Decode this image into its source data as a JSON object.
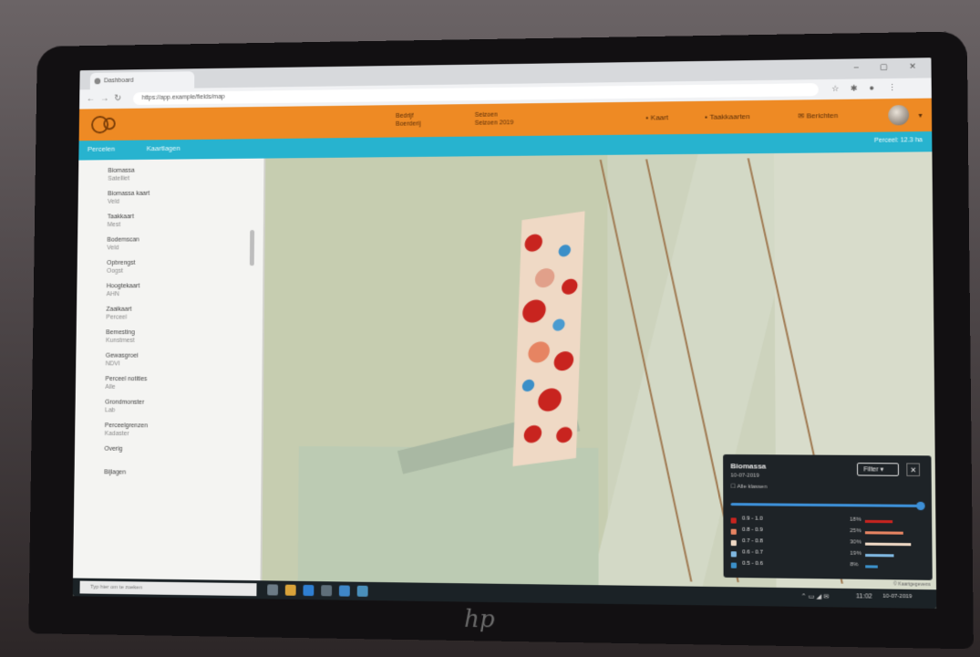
{
  "browser": {
    "tab_title": "Dashboard",
    "address": "https://app.example/fields/map",
    "window_controls": "– ▢ ✕"
  },
  "header": {
    "farm_selector_label": "Bedrijf",
    "farm_selector_value": "Boerderij",
    "period_label": "Seizoen",
    "period_value": "Seizoen 2019",
    "kaart_label": "Kaart",
    "taskmaps_label": "Taakkaarten",
    "berichten_label": "Berichten",
    "colors": {
      "accent": "#ee8a24",
      "sub_bar": "#27b3cf"
    }
  },
  "subbar": {
    "tab_fields": "Percelen",
    "tab_layers": "Kaartlagen",
    "right_text": "Perceel: 12.3 ha"
  },
  "sidebar": {
    "items": [
      {
        "label": "Biomassa",
        "sub": "Satelliet"
      },
      {
        "label": "Biomassa kaart",
        "sub": "Veld"
      },
      {
        "label": "Taakkaart",
        "sub": "Mest"
      },
      {
        "label": "Bodemscan",
        "sub": "Veld"
      },
      {
        "label": "Opbrengst",
        "sub": "Oogst"
      },
      {
        "label": "Hoogtekaart",
        "sub": "AHN"
      },
      {
        "label": "Zaaikaart",
        "sub": "Perceel"
      },
      {
        "label": "Bemesting",
        "sub": "Kunstmest"
      },
      {
        "label": "Gewasgroei",
        "sub": "NDVI"
      },
      {
        "label": "Perceel notities",
        "sub": "Alle"
      },
      {
        "label": "Grondmonster",
        "sub": "Lab"
      },
      {
        "label": "Perceelgrenzen",
        "sub": "Kadaster"
      },
      {
        "label": "Overig",
        "sub": ""
      },
      {
        "label": "Bijlagen",
        "sub": ""
      }
    ]
  },
  "legend": {
    "title": "Biomassa",
    "date": "10-07-2019",
    "checkbox_label": "Alle klassen",
    "filter_label": "Filter",
    "close_label": "✕",
    "rows": [
      {
        "range": "0.9 - 1.0",
        "pct": "18%",
        "color": "#c8241f",
        "fraction": 0.18
      },
      {
        "range": "0.8 - 0.9",
        "pct": "25%",
        "color": "#e68462",
        "fraction": 0.25
      },
      {
        "range": "0.7 - 0.8",
        "pct": "30%",
        "color": "#efd9c5",
        "fraction": 0.3
      },
      {
        "range": "0.6 - 0.7",
        "pct": "19%",
        "color": "#7fb7e0",
        "fraction": 0.19
      },
      {
        "range": "0.5 - 0.6",
        "pct": "8%",
        "color": "#3b8fc8",
        "fraction": 0.08
      }
    ]
  },
  "taskbar": {
    "search_placeholder": "Typ hier om te zoeken",
    "time": "11:02",
    "date": "10-07-2019"
  },
  "map": {
    "credit": "© Kaartgegevens"
  },
  "device": {
    "logo": "hp"
  }
}
